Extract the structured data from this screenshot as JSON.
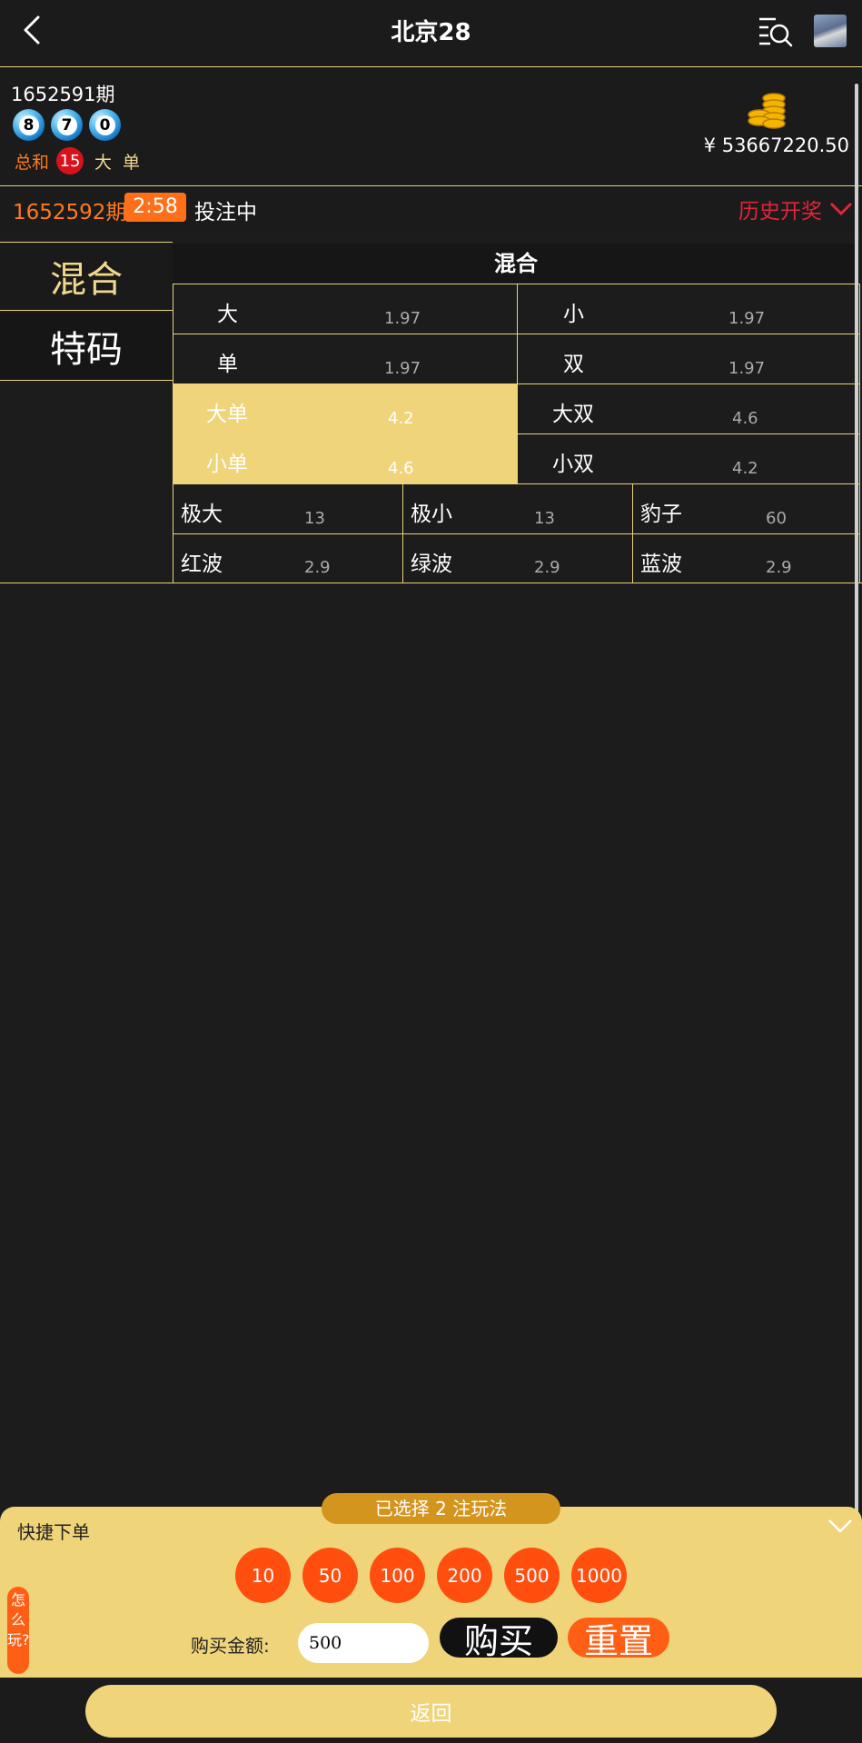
{
  "header": {
    "title": "北京28",
    "icons": [
      "back-arrow-icon",
      "list-search-icon",
      "avatar"
    ]
  },
  "last_draw": {
    "issue": "1652591期",
    "balls": [
      "8",
      "7",
      "0"
    ],
    "sum_label": "总和",
    "sum_value": "15",
    "result_size": "大",
    "result_parity": "单",
    "balance": "¥ 53667220.50"
  },
  "current": {
    "issue": "1652592期",
    "countdown": "2:58",
    "status": "投注中",
    "history_label": "历史开奖"
  },
  "tabs": [
    {
      "label": "混合",
      "active": true
    },
    {
      "label": "特码",
      "active": false
    }
  ],
  "grid": {
    "title": "混合",
    "cells": [
      {
        "name": "大",
        "odds": "1.97",
        "selected": false
      },
      {
        "name": "小",
        "odds": "1.97",
        "selected": false
      },
      {
        "name": "单",
        "odds": "1.97",
        "selected": false
      },
      {
        "name": "双",
        "odds": "1.97",
        "selected": false
      },
      {
        "name": "大单",
        "odds": "4.2",
        "selected": true
      },
      {
        "name": "大双",
        "odds": "4.6",
        "selected": false
      },
      {
        "name": "小单",
        "odds": "4.6",
        "selected": true
      },
      {
        "name": "小双",
        "odds": "4.2",
        "selected": false
      },
      {
        "name": "极大",
        "odds": "13",
        "selected": false
      },
      {
        "name": "极小",
        "odds": "13",
        "selected": false
      },
      {
        "name": "豹子",
        "odds": "60",
        "selected": false
      },
      {
        "name": "红波",
        "odds": "2.9",
        "selected": false
      },
      {
        "name": "绿波",
        "odds": "2.9",
        "selected": false
      },
      {
        "name": "蓝波",
        "odds": "2.9",
        "selected": false
      }
    ]
  },
  "quick_bet": {
    "selected_text": "已选择 2 注玩法",
    "title": "快捷下单",
    "chips": [
      "10",
      "50",
      "100",
      "200",
      "500",
      "1000"
    ],
    "how_to_play": "怎么玩?",
    "amount_label": "购买金额:",
    "amount_value": "500",
    "buy_label": "购买",
    "reset_label": "重置"
  },
  "footer": {
    "return_label": "返回"
  },
  "colors": {
    "accent_gold": "#efd47a",
    "orange": "#ff6f1a",
    "red": "#e1253a",
    "background": "#1c1c1c"
  }
}
